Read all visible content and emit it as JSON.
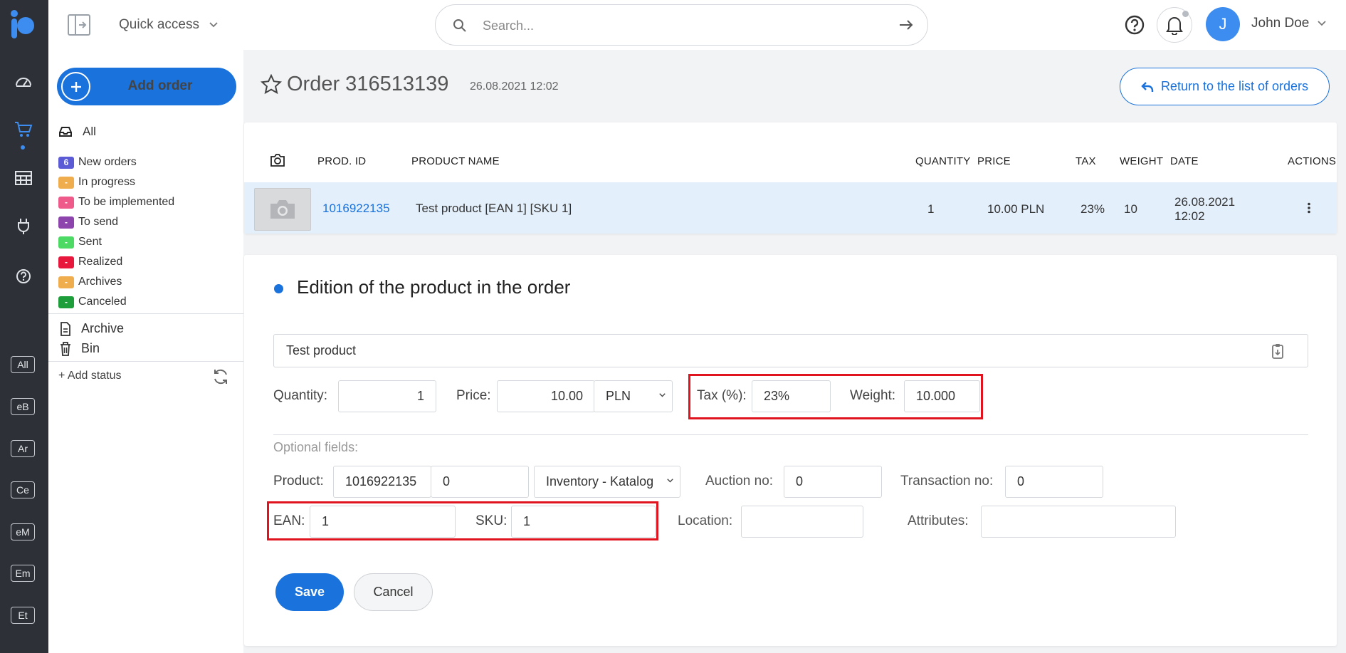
{
  "colors": {
    "primary": "#1a72dc",
    "rail": "#2d3137",
    "highlight": "#e0141e",
    "row_selected": "#e3effb"
  },
  "rail": {
    "icons": [
      "logo-icon",
      "dashboard-icon",
      "cart-icon",
      "warehouse-icon",
      "plug-icon",
      "help-circle-icon"
    ],
    "badges": [
      "All",
      "eB",
      "Ar",
      "Ce",
      "eM",
      "Em",
      "Et"
    ]
  },
  "topbar": {
    "quick_access": "Quick access",
    "search_placeholder": "Search...",
    "user": {
      "initial": "J",
      "name": "John Doe"
    }
  },
  "sidebar": {
    "add_order": "Add order",
    "all": "All",
    "statuses": [
      {
        "badge": "6",
        "label": "New orders",
        "color": "#5b5bd6"
      },
      {
        "badge": "-",
        "label": "In progress",
        "color": "#f0ad4e"
      },
      {
        "badge": "-",
        "label": "To be implemented",
        "color": "#ee5a8a"
      },
      {
        "badge": "-",
        "label": "To send",
        "color": "#8e44ad"
      },
      {
        "badge": "-",
        "label": "Sent",
        "color": "#4cd964"
      },
      {
        "badge": "-",
        "label": "Realized",
        "color": "#e8173c"
      },
      {
        "badge": "-",
        "label": "Archives",
        "color": "#f0ad4e"
      },
      {
        "badge": "-",
        "label": "Canceled",
        "color": "#1e9e3a"
      }
    ],
    "archive": "Archive",
    "bin": "Bin",
    "add_status": "+ Add status"
  },
  "header": {
    "title": "Order 316513139",
    "date": "26.08.2021 12:02",
    "return_label": "Return to the list of orders"
  },
  "table": {
    "columns": {
      "prod_id": "PROD. ID",
      "name": "PRODUCT NAME",
      "quantity": "QUANTITY",
      "price": "PRICE",
      "tax": "TAX",
      "weight": "WEIGHT",
      "date": "DATE",
      "actions": "ACTIONS"
    },
    "row": {
      "prod_id": "1016922135",
      "name": "Test product [EAN 1] [SKU 1]",
      "quantity": "1",
      "price": "10.00 PLN",
      "tax": "23%",
      "weight": "10",
      "date_line1": "26.08.2021",
      "date_line2": "12:02"
    }
  },
  "edit": {
    "title": "Edition of the product in the order",
    "product_name": "Test product",
    "quantity_label": "Quantity:",
    "quantity": "1",
    "price_label": "Price:",
    "price": "10.00",
    "currency": "PLN",
    "tax_label": "Tax (%):",
    "tax": "23%",
    "weight_label": "Weight:",
    "weight": "10.000",
    "optional_title": "Optional fields:",
    "product_label": "Product:",
    "product_id": "1016922135",
    "variant_id": "0",
    "inventory": "Inventory - Katalog",
    "auction_label": "Auction no:",
    "auction": "0",
    "transaction_label": "Transaction no:",
    "transaction": "0",
    "ean_label": "EAN:",
    "ean": "1",
    "sku_label": "SKU:",
    "sku": "1",
    "location_label": "Location:",
    "location": "",
    "attributes_label": "Attributes:",
    "attributes": "",
    "save": "Save",
    "cancel": "Cancel"
  }
}
